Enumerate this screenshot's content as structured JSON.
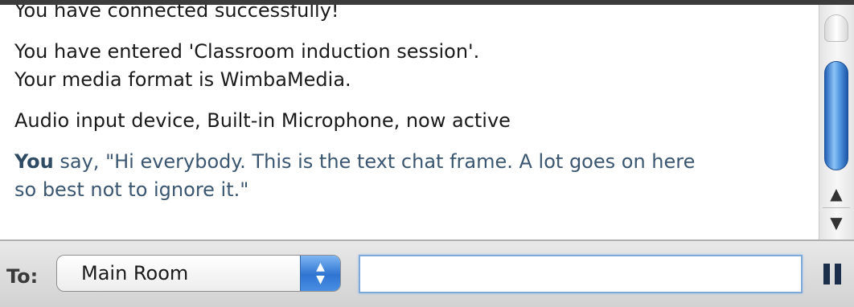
{
  "chat": {
    "messages": [
      {
        "text": "You have connected successfully!"
      },
      {
        "lines": [
          "You have entered 'Classroom induction session'.",
          "Your media format is WimbaMedia."
        ]
      },
      {
        "text": "Audio input device, Built-in Microphone, now active"
      },
      {
        "speaker": "You",
        "said": "say, \"Hi everybody. This is the text chat frame. A lot goes on here",
        "said_cont": "so best not to ignore it.\""
      }
    ]
  },
  "scrollbar": {
    "up_arrow": "▲",
    "down_arrow": "▼"
  },
  "composer": {
    "to_label": "To:",
    "recipient": "Main Room",
    "select_arrows": "▲▼",
    "input_value": ""
  },
  "colors": {
    "speaker": "#2f4b63",
    "thumb": "#3b82d8"
  },
  "icons": {
    "pause": "pause-icon"
  }
}
